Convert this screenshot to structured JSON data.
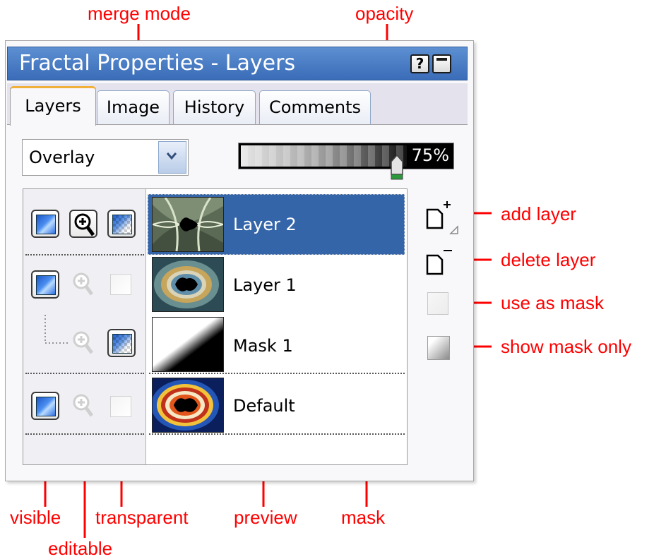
{
  "annotations": {
    "merge_mode": "merge mode",
    "opacity": "opacity",
    "add_layer": "add layer",
    "delete_layer": "delete layer",
    "use_as_mask": "use as mask",
    "show_mask_only": "show mask only",
    "visible": "visible",
    "editable": "editable",
    "transparent": "transparent",
    "preview": "preview",
    "mask": "mask"
  },
  "window": {
    "title": "Fractal Properties - Layers",
    "help_label": "?"
  },
  "tabs": [
    {
      "label": "Layers",
      "active": true
    },
    {
      "label": "Image",
      "active": false
    },
    {
      "label": "History",
      "active": false
    },
    {
      "label": "Comments",
      "active": false
    }
  ],
  "merge_mode": {
    "value": "Overlay"
  },
  "opacity": {
    "label": "75%",
    "value": 0.75
  },
  "layers": [
    {
      "name": "Layer 2",
      "selected": true
    },
    {
      "name": "Layer 1",
      "selected": false
    },
    {
      "name": "Mask 1",
      "selected": false
    },
    {
      "name": "Default",
      "selected": false
    }
  ],
  "colors": {
    "annotation": "#ff0000",
    "titlebar": "#3a6cb8",
    "selection": "#3465a9",
    "active_tab_accent": "#f1b03a"
  },
  "icons": {
    "visible": "visible-eye-icon",
    "editable": "magnifier-icon",
    "transparent": "transparency-icon",
    "add_layer": "add-layer-icon",
    "delete_layer": "delete-layer-icon",
    "use_as_mask": "use-as-mask-icon",
    "show_mask_only": "show-mask-only-icon"
  }
}
